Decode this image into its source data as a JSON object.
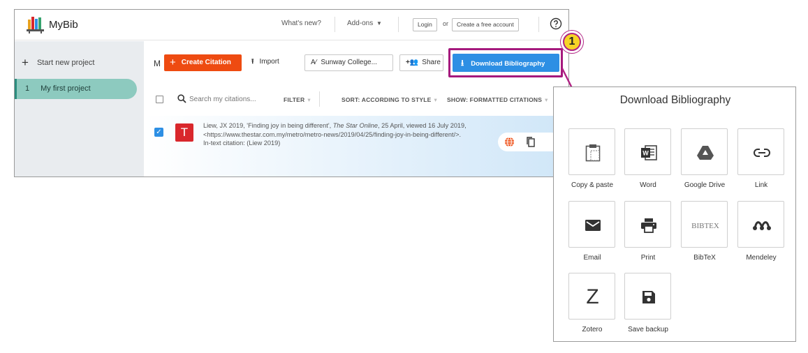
{
  "header": {
    "brand": "MyBib",
    "whats_new": "What's new?",
    "addons": "Add-ons",
    "login": "Login",
    "or": "or",
    "create_account": "Create a free account"
  },
  "sidebar": {
    "start_new": "Start new project",
    "project_number": "1",
    "project_name": "My first project"
  },
  "main": {
    "title_initial": "M",
    "create_citation": "Create Citation",
    "import": "Import",
    "style": "Sunway College...",
    "share": "Share",
    "download_bibliography": "Download Bibliography",
    "search_placeholder": "Search my citations...",
    "filter": "FILTER",
    "sort": "SORT: ACCORDING TO STYLE",
    "show": "SHOW: FORMATTED CITATIONS"
  },
  "citation": {
    "badge": "T",
    "part1": "Liew, JX 2019, 'Finding joy in being different', ",
    "source": "The Star Online",
    "part2": ", 25 April, viewed 16 July 2019, <https://www.thestar.com.my/metro/metro-news/2019/04/25/finding-joy-in-being-different/>.",
    "in_text": "In-text citation: (Liew 2019)"
  },
  "popup": {
    "title": "Download Bibliography",
    "options": [
      {
        "label": "Copy & paste",
        "icon": "clipboard-icon"
      },
      {
        "label": "Word",
        "icon": "word-icon"
      },
      {
        "label": "Google Drive",
        "icon": "google-drive-icon"
      },
      {
        "label": "Link",
        "icon": "link-icon"
      },
      {
        "label": "Email",
        "icon": "email-icon"
      },
      {
        "label": "Print",
        "icon": "printer-icon"
      },
      {
        "label": "BibTeX",
        "icon": "bibtex-icon"
      },
      {
        "label": "Mendeley",
        "icon": "mendeley-icon"
      },
      {
        "label": "Zotero",
        "icon": "zotero-icon"
      },
      {
        "label": "Save backup",
        "icon": "floppy-disk-icon"
      }
    ]
  },
  "annotation": {
    "step_number": "1"
  },
  "colors": {
    "create_citation": "#ee4b11",
    "download_button": "#2d8fe4",
    "highlight": "#a5197d",
    "marker": "#f6d426",
    "active_project": "#8dcabf",
    "badge": "#d9272c"
  }
}
